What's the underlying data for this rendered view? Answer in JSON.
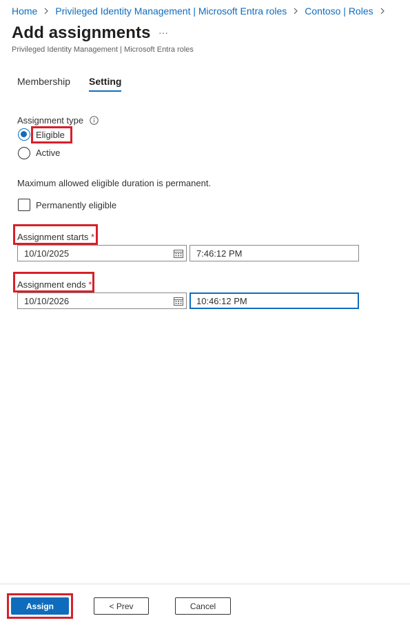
{
  "breadcrumb": [
    {
      "label": "Home"
    },
    {
      "label": "Privileged Identity Management | Microsoft Entra roles"
    },
    {
      "label": "Contoso | Roles"
    }
  ],
  "header": {
    "title": "Add assignments",
    "more_label": "···",
    "subtitle": "Privileged Identity Management | Microsoft Entra roles"
  },
  "tabs": [
    {
      "label": "Membership",
      "selected": false
    },
    {
      "label": "Setting",
      "selected": true
    }
  ],
  "assignment_type": {
    "label": "Assignment type",
    "info_icon": "info-icon",
    "options": [
      {
        "label": "Eligible",
        "checked": true
      },
      {
        "label": "Active",
        "checked": false
      }
    ]
  },
  "duration_note": "Maximum allowed eligible duration is permanent.",
  "permanent": {
    "label": "Permanently eligible",
    "checked": false
  },
  "starts": {
    "label": "Assignment starts",
    "required_mark": "*",
    "date": "10/10/2025",
    "time": "7:46:12 PM"
  },
  "ends": {
    "label": "Assignment ends",
    "required_mark": "*",
    "date": "10/10/2026",
    "time": "10:46:12 PM"
  },
  "footer": {
    "assign_label": "Assign",
    "prev_label": "< Prev",
    "cancel_label": "Cancel"
  },
  "colors": {
    "accent": "#0f6cbd",
    "highlight": "#d6202a"
  }
}
